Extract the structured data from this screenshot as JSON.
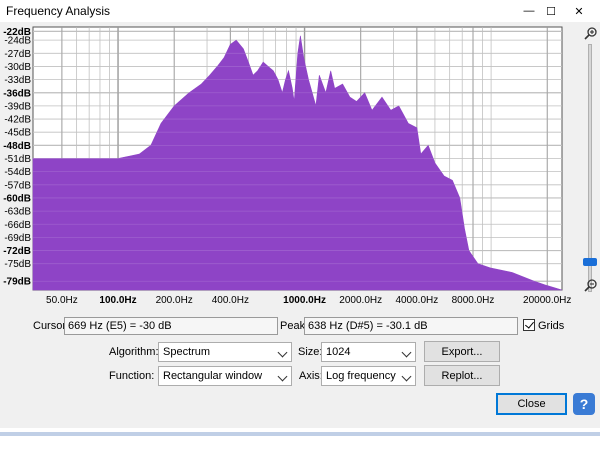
{
  "window": {
    "title": "Frequency Analysis",
    "controls": {
      "minimize": "—",
      "maximize": "☐",
      "close": "✕"
    }
  },
  "readouts": {
    "cursor_label": "Cursor:",
    "cursor_value": "669 Hz (E5) = -30 dB",
    "peak_label": "Peak:",
    "peak_value": "638 Hz (D#5) = -30.1 dB",
    "grids_label": "Grids",
    "grids_checked": true
  },
  "options": {
    "algorithm_label": "Algorithm:",
    "algorithm_value": "Spectrum",
    "size_label": "Size:",
    "size_value": "1024",
    "function_label": "Function:",
    "function_value": "Rectangular window",
    "axis_label": "Axis:",
    "axis_value": "Log frequency"
  },
  "buttons": {
    "export": "Export...",
    "replot": "Replot...",
    "close": "Close",
    "help": "?"
  },
  "colors": {
    "spectrum_fill": "#8e44c6",
    "grid": "#b8b8b8",
    "plot_bg": "#ffffff",
    "accent": "#0078d7"
  },
  "chart_data": {
    "type": "area",
    "x_scale": "log",
    "xlim": [
      35,
      24000
    ],
    "ylim": [
      -81,
      -21
    ],
    "y_ticks": [
      {
        "v": -22,
        "label": "-22dB",
        "bold": true
      },
      {
        "v": -24,
        "label": "-24dB",
        "bold": false
      },
      {
        "v": -27,
        "label": "-27dB",
        "bold": false
      },
      {
        "v": -30,
        "label": "-30dB",
        "bold": false
      },
      {
        "v": -33,
        "label": "-33dB",
        "bold": false
      },
      {
        "v": -36,
        "label": "-36dB",
        "bold": true
      },
      {
        "v": -39,
        "label": "-39dB",
        "bold": false
      },
      {
        "v": -42,
        "label": "-42dB",
        "bold": false
      },
      {
        "v": -45,
        "label": "-45dB",
        "bold": false
      },
      {
        "v": -48,
        "label": "-48dB",
        "bold": true
      },
      {
        "v": -51,
        "label": "-51dB",
        "bold": false
      },
      {
        "v": -54,
        "label": "-54dB",
        "bold": false
      },
      {
        "v": -57,
        "label": "-57dB",
        "bold": false
      },
      {
        "v": -60,
        "label": "-60dB",
        "bold": true
      },
      {
        "v": -63,
        "label": "-63dB",
        "bold": false
      },
      {
        "v": -66,
        "label": "-66dB",
        "bold": false
      },
      {
        "v": -69,
        "label": "-69dB",
        "bold": false
      },
      {
        "v": -72,
        "label": "-72dB",
        "bold": true
      },
      {
        "v": -75,
        "label": "-75dB",
        "bold": false
      },
      {
        "v": -79,
        "label": "-79dB",
        "bold": true
      }
    ],
    "x_ticks": [
      {
        "v": 50,
        "label": "50.0Hz",
        "bold": false
      },
      {
        "v": 100,
        "label": "100.0Hz",
        "bold": true
      },
      {
        "v": 200,
        "label": "200.0Hz",
        "bold": false
      },
      {
        "v": 400,
        "label": "400.0Hz",
        "bold": false
      },
      {
        "v": 1000,
        "label": "1000.0Hz",
        "bold": true
      },
      {
        "v": 2000,
        "label": "2000.0Hz",
        "bold": false
      },
      {
        "v": 4000,
        "label": "4000.0Hz",
        "bold": false
      },
      {
        "v": 8000,
        "label": "8000.0Hz",
        "bold": false
      },
      {
        "v": 20000,
        "label": "20000.0Hz",
        "bold": false
      }
    ],
    "minor_x": [
      60,
      70,
      80,
      90,
      300,
      500,
      600,
      700,
      800,
      900,
      3000,
      5000,
      6000,
      7000,
      9000,
      10000
    ],
    "series": [
      {
        "points": [
          [
            35,
            -51
          ],
          [
            60,
            -51
          ],
          [
            100,
            -51
          ],
          [
            130,
            -50
          ],
          [
            150,
            -48
          ],
          [
            170,
            -43
          ],
          [
            200,
            -39
          ],
          [
            240,
            -36
          ],
          [
            280,
            -34
          ],
          [
            310,
            -32
          ],
          [
            340,
            -30
          ],
          [
            370,
            -28
          ],
          [
            400,
            -25
          ],
          [
            430,
            -24
          ],
          [
            470,
            -26
          ],
          [
            500,
            -29
          ],
          [
            530,
            -32
          ],
          [
            560,
            -31
          ],
          [
            600,
            -29
          ],
          [
            638,
            -30
          ],
          [
            680,
            -31
          ],
          [
            720,
            -33
          ],
          [
            760,
            -36
          ],
          [
            790,
            -33
          ],
          [
            820,
            -31
          ],
          [
            860,
            -35
          ],
          [
            880,
            -38
          ],
          [
            920,
            -27
          ],
          [
            950,
            -23
          ],
          [
            990,
            -28
          ],
          [
            1050,
            -33
          ],
          [
            1150,
            -39
          ],
          [
            1200,
            -32
          ],
          [
            1300,
            -36
          ],
          [
            1380,
            -31
          ],
          [
            1450,
            -35
          ],
          [
            1600,
            -34
          ],
          [
            1750,
            -37
          ],
          [
            1900,
            -38
          ],
          [
            2100,
            -36
          ],
          [
            2300,
            -40
          ],
          [
            2600,
            -37
          ],
          [
            2900,
            -40
          ],
          [
            3200,
            -39
          ],
          [
            3600,
            -43
          ],
          [
            4000,
            -44
          ],
          [
            4200,
            -50
          ],
          [
            4600,
            -48
          ],
          [
            5000,
            -52
          ],
          [
            5600,
            -55
          ],
          [
            6200,
            -56
          ],
          [
            6800,
            -60
          ],
          [
            7200,
            -67
          ],
          [
            7600,
            -72
          ],
          [
            8500,
            -75
          ],
          [
            10000,
            -76
          ],
          [
            13000,
            -77
          ],
          [
            17000,
            -79
          ],
          [
            20000,
            -80
          ],
          [
            24000,
            -81
          ]
        ]
      }
    ]
  }
}
